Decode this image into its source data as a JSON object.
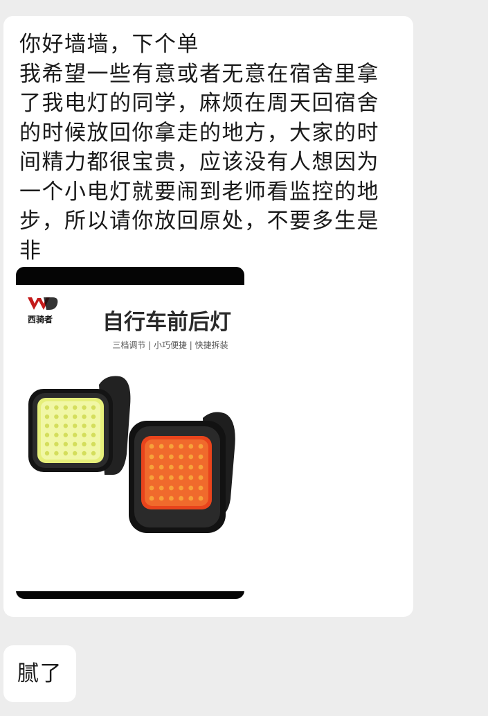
{
  "messages": [
    {
      "text": "你好墙墙，下个单\n我希望一些有意或者无意在宿舍里拿了我电灯的同学，麻烦在周天回宿舍的时候放回你拿走的地方，大家的时间精力都很宝贵，应该没有人想因为一个小电灯就要闹到老师看监控的地步，所以请你放回原处，不要多生是非",
      "image": {
        "brand_logo_text": "西骑者",
        "title": "自行车前后灯",
        "subtitle": "三档调节 | 小巧便捷 | 快捷拆装",
        "icon": "bike-light-product-photo",
        "colors": {
          "front_light": "#e6ef7a",
          "rear_light": "#e8441c",
          "housing": "#1a1a1a"
        }
      }
    },
    {
      "text": "腻了"
    }
  ]
}
